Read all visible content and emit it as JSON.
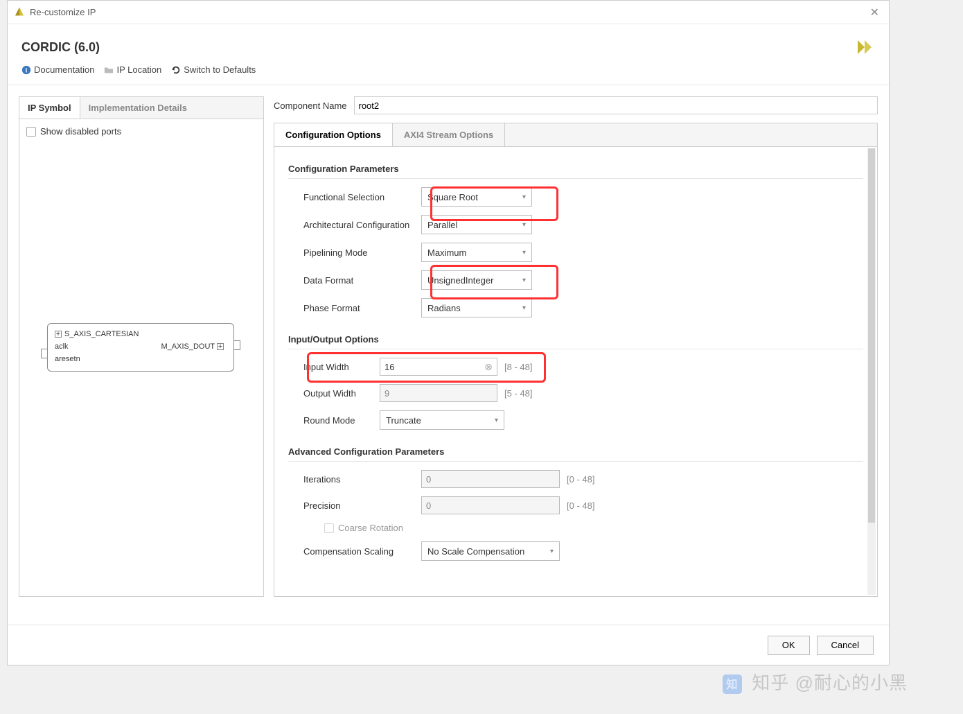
{
  "window": {
    "title": "Re-customize IP"
  },
  "header": {
    "title": "CORDIC (6.0)"
  },
  "toolbar": {
    "documentation": "Documentation",
    "ip_location": "IP Location",
    "switch_defaults": "Switch to Defaults"
  },
  "left": {
    "tab_symbol": "IP Symbol",
    "tab_impl": "Implementation Details",
    "show_disabled": "Show disabled ports",
    "ip": {
      "in1": "S_AXIS_CARTESIAN",
      "in2": "aclk",
      "in3": "aresetn",
      "out1": "M_AXIS_DOUT"
    }
  },
  "component": {
    "label": "Component Name",
    "value": "root2"
  },
  "tabs": {
    "config": "Configuration Options",
    "axi4": "AXI4 Stream Options"
  },
  "sections": {
    "config_params": "Configuration Parameters",
    "io_options": "Input/Output Options",
    "advanced": "Advanced Configuration Parameters"
  },
  "params": {
    "func_sel": {
      "label": "Functional Selection",
      "value": "Square Root"
    },
    "arch": {
      "label": "Architectural Configuration",
      "value": "Parallel"
    },
    "pipe": {
      "label": "Pipelining Mode",
      "value": "Maximum"
    },
    "dataf": {
      "label": "Data Format",
      "value": "UnsignedInteger"
    },
    "phasef": {
      "label": "Phase Format",
      "value": "Radians"
    },
    "in_width": {
      "label": "Input Width",
      "value": "16",
      "range": "[8 - 48]"
    },
    "out_width": {
      "label": "Output Width",
      "value": "9",
      "range": "[5 - 48]"
    },
    "round": {
      "label": "Round Mode",
      "value": "Truncate"
    },
    "iter": {
      "label": "Iterations",
      "value": "0",
      "range": "[0 - 48]"
    },
    "prec": {
      "label": "Precision",
      "value": "0",
      "range": "[0 - 48]"
    },
    "coarse": {
      "label": "Coarse Rotation"
    },
    "comp": {
      "label": "Compensation Scaling",
      "value": "No Scale Compensation"
    }
  },
  "footer": {
    "ok": "OK",
    "cancel": "Cancel"
  },
  "watermark": "知乎 @耐心的小黑"
}
